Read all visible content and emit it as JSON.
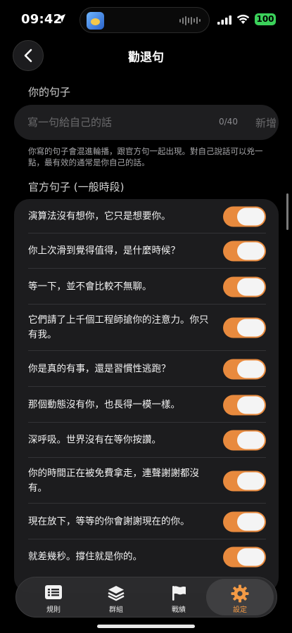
{
  "status_bar": {
    "time": "09:42",
    "battery": "100",
    "battery_color": "#3bd15a"
  },
  "nav": {
    "title": "勸退句",
    "back_icon": "chevron-left-icon"
  },
  "your_sentence": {
    "section_title": "你的句子",
    "placeholder": "寫一句給自己的話",
    "value": "",
    "char_count": "0/40",
    "add_label": "新增",
    "help_text": "你寫的句子會混進輪播，跟官方句一起出現。對自己說話可以兇一點，最有效的通常是你自己的話。"
  },
  "official": {
    "section_title": "官方句子 (一般時段)",
    "accent_color": "#e88a3e",
    "items": [
      {
        "text": "演算法沒有想你，它只是想要你。",
        "enabled": true
      },
      {
        "text": "你上次滑到覺得值得，是什麼時候？",
        "enabled": true
      },
      {
        "text": "等一下，並不會比較不無聊。",
        "enabled": true
      },
      {
        "text": "它們請了上千個工程師搶你的注意力。你只有我。",
        "enabled": true
      },
      {
        "text": "你是真的有事，還是習慣性逃跑？",
        "enabled": true
      },
      {
        "text": "那個動態沒有你，也長得一模一樣。",
        "enabled": true
      },
      {
        "text": "深呼吸。世界沒有在等你按讚。",
        "enabled": true
      },
      {
        "text": "你的時間正在被免費拿走，連聲謝謝都沒有。",
        "enabled": true
      },
      {
        "text": "現在放下，等等的你會謝謝現在的你。",
        "enabled": true
      },
      {
        "text": "就差幾秒。撐住就是你的。",
        "enabled": true
      }
    ]
  },
  "tabbar": {
    "tabs": [
      {
        "label": "規則",
        "icon": "list-icon",
        "active": false
      },
      {
        "label": "群組",
        "icon": "layers-icon",
        "active": false
      },
      {
        "label": "戰績",
        "icon": "flag-icon",
        "active": false
      },
      {
        "label": "設定",
        "icon": "gear-icon",
        "active": true
      }
    ],
    "active_color": "#f39a45"
  }
}
